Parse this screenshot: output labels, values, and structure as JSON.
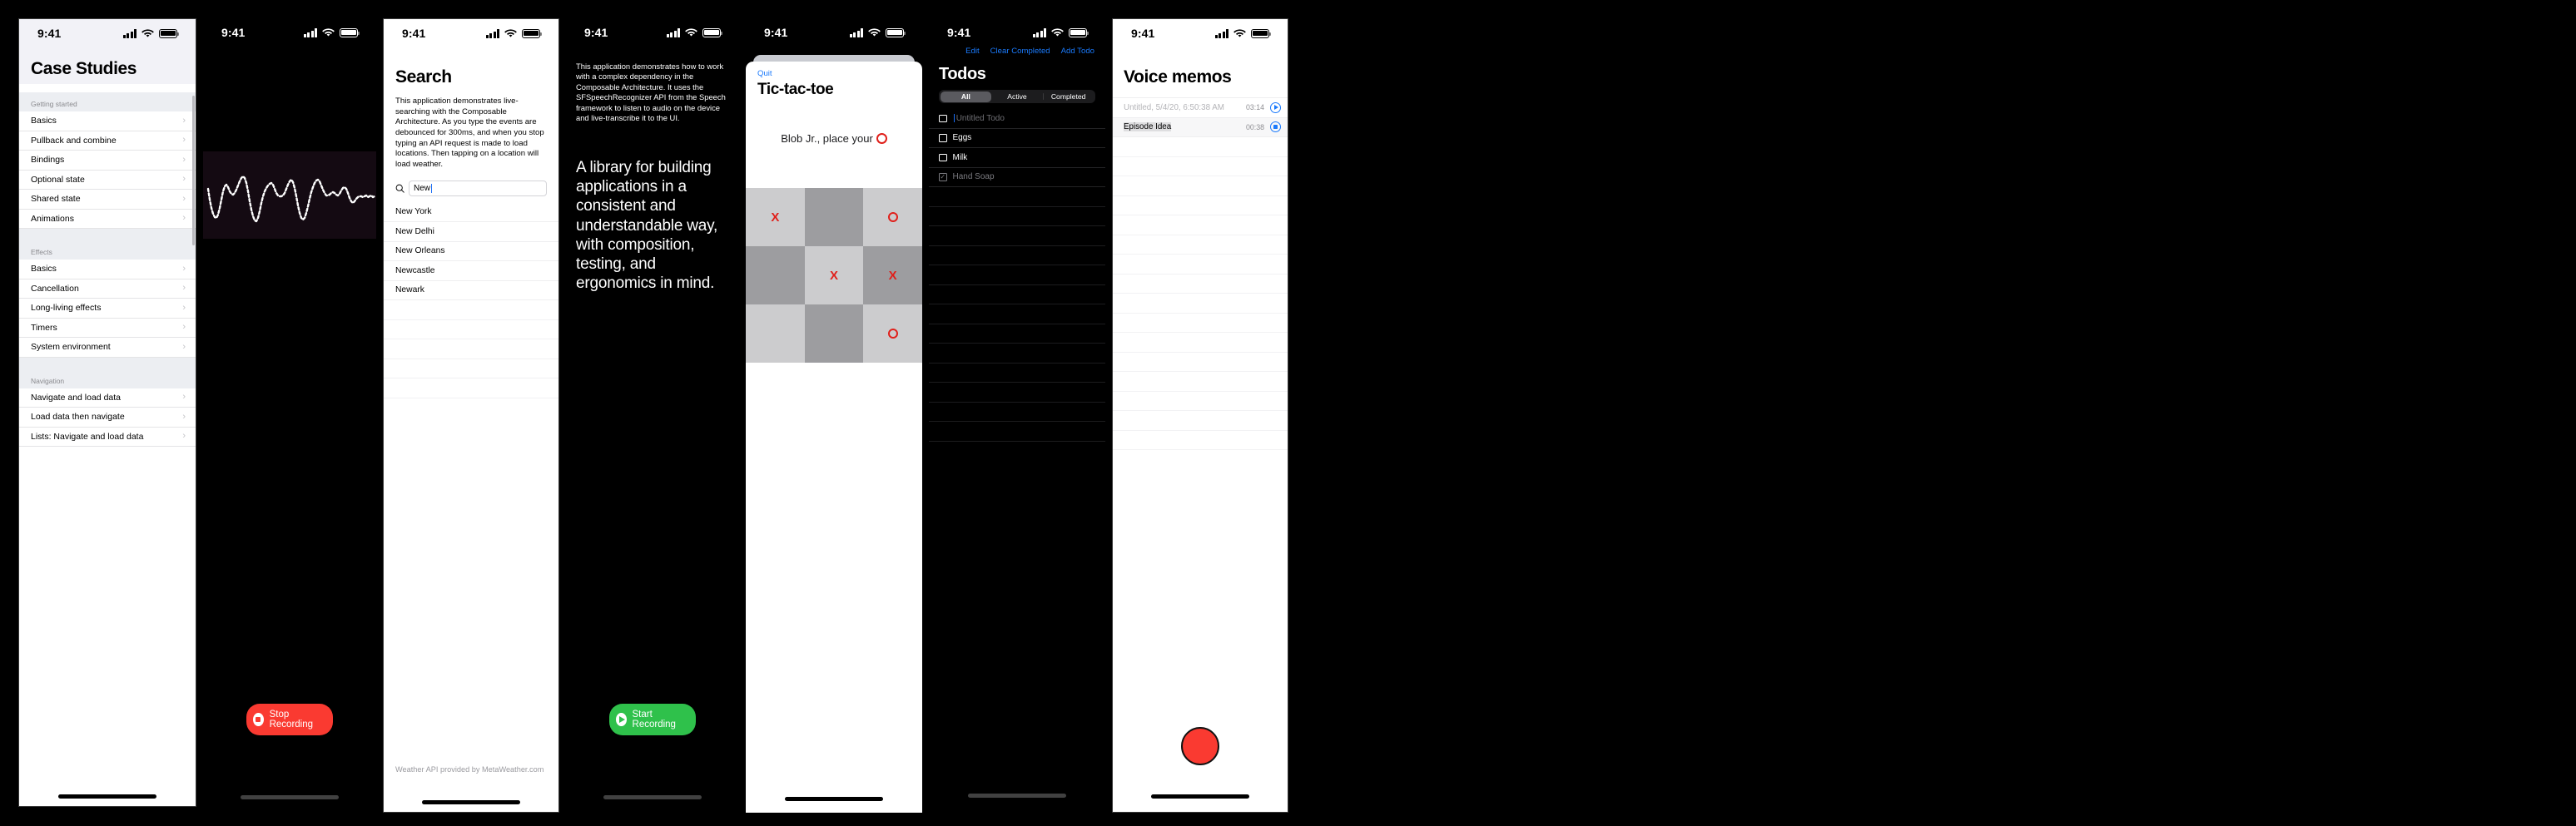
{
  "common": {
    "time": "9:41"
  },
  "phone1": {
    "title": "Case Studies",
    "sections": [
      {
        "header": "Getting started",
        "items": [
          "Basics",
          "Pullback and combine",
          "Bindings",
          "Optional state",
          "Shared state",
          "Animations"
        ]
      },
      {
        "header": "Effects",
        "items": [
          "Basics",
          "Cancellation",
          "Long-living effects",
          "Timers",
          "System environment"
        ]
      },
      {
        "header": "Navigation",
        "items": [
          "Navigate and load data",
          "Load data then navigate",
          "Lists: Navigate and load data"
        ]
      }
    ],
    "chevron": "›"
  },
  "phone2": {
    "button": {
      "label": "Stop Recording",
      "icon": "stop-icon",
      "color": "#fa3a31"
    }
  },
  "phone3": {
    "title": "Search",
    "description": "This application demonstrates live-searching with the Composable Architecture. As you type the events are debounced for 300ms, and when you stop typing an API request is made to load locations. Then tapping on a location will load weather.",
    "search": {
      "value": "New",
      "icon": "search-icon"
    },
    "results": [
      "New York",
      "New Delhi",
      "New Orleans",
      "Newcastle",
      "Newark"
    ],
    "footer": "Weather API provided by MetaWeather.com"
  },
  "phone4": {
    "description": "This application demonstrates how to work with a complex dependency in the Composable Architecture. It uses the SFSpeechRecognizer API from the Speech framework to listen to audio on the device and live-transcribe it to the UI.",
    "transcript": "A library for building applications in a consistent and understandable way, with composition, testing, and ergonomics in mind.",
    "button": {
      "label": "Start Recording",
      "icon": "play-icon",
      "color": "#2fc14b"
    }
  },
  "phone5": {
    "quit": "Quit",
    "title": "Tic-tac-toe",
    "status_prefix": "Blob Jr., place your",
    "status_mark": "O",
    "board": [
      [
        {
          "mark": "X",
          "shade": "lt"
        },
        {
          "mark": "",
          "shade": "dk"
        },
        {
          "mark": "O",
          "shade": "lt"
        }
      ],
      [
        {
          "mark": "",
          "shade": "dk"
        },
        {
          "mark": "X",
          "shade": "lt"
        },
        {
          "mark": "X",
          "shade": "dk"
        }
      ],
      [
        {
          "mark": "",
          "shade": "lt"
        },
        {
          "mark": "",
          "shade": "dk"
        },
        {
          "mark": "O",
          "shade": "lt"
        }
      ]
    ]
  },
  "phone6": {
    "nav": {
      "edit": "Edit",
      "clear": "Clear Completed",
      "add": "Add Todo"
    },
    "title": "Todos",
    "filters": [
      {
        "label": "All",
        "selected": true
      },
      {
        "label": "Active",
        "selected": false
      },
      {
        "label": "Completed",
        "selected": false
      }
    ],
    "todos": [
      {
        "text": "Untitled Todo",
        "completed": false,
        "placeholder": true
      },
      {
        "text": "Eggs",
        "completed": false,
        "placeholder": false
      },
      {
        "text": "Milk",
        "completed": false,
        "placeholder": false
      },
      {
        "text": "Hand Soap",
        "completed": true,
        "placeholder": false
      }
    ],
    "checkmark": "✓"
  },
  "phone7": {
    "title": "Voice memos",
    "memos": [
      {
        "name": "Untitled, 5/4/20, 6:50:38 AM",
        "duration": "03:14",
        "state": "play",
        "muted": true,
        "highlighted": false
      },
      {
        "name": "Episode Idea",
        "duration": "00:38",
        "state": "stop",
        "muted": false,
        "highlighted": true
      }
    ],
    "record_color": "#fa3a31"
  }
}
